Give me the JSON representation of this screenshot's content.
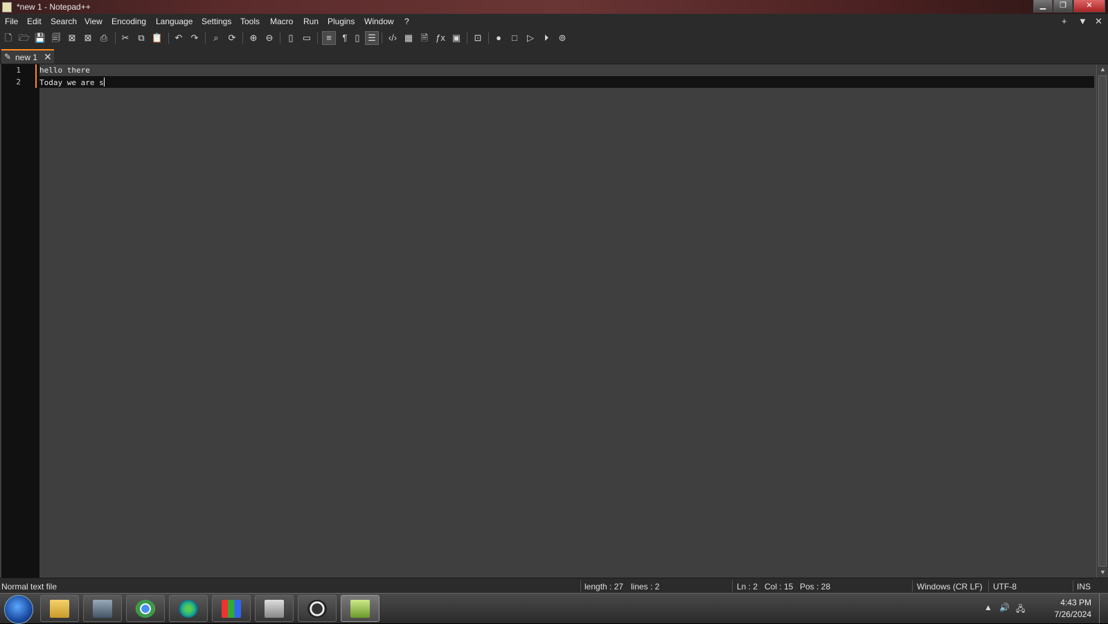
{
  "window": {
    "title": "*new 1 - Notepad++",
    "controls": [
      "minimize",
      "restore",
      "close"
    ]
  },
  "menu": {
    "items": [
      "File",
      "Edit",
      "Search",
      "View",
      "Encoding",
      "Language",
      "Settings",
      "Tools",
      "Macro",
      "Run",
      "Plugins",
      "Window",
      "?"
    ],
    "right_controls": [
      "+",
      "▼",
      "✕"
    ]
  },
  "toolbar": {
    "icons": [
      "new-file-icon",
      "open-file-icon",
      "save-icon",
      "save-all-icon",
      "close-icon",
      "close-all-icon",
      "print-icon",
      "cut-icon",
      "copy-icon",
      "paste-icon",
      "undo-icon",
      "redo-icon",
      "find-icon",
      "replace-icon",
      "zoom-in-icon",
      "zoom-out-icon",
      "sync-vertical-icon",
      "sync-horizontal-icon",
      "word-wrap-icon",
      "show-all-chars-icon",
      "indent-guide-icon",
      "doc-map-icon",
      "udl-icon",
      "function-list-icon",
      "folder-workspace-icon",
      "function-icon",
      "monitoring-icon",
      "doc-switcher-icon",
      "record-macro-icon",
      "stop-record-icon",
      "play-macro-icon",
      "run-macro-multiple-icon",
      "save-macro-icon"
    ]
  },
  "tab": {
    "label": "new 1",
    "close": "✕"
  },
  "editor": {
    "lines": [
      {
        "num": "1",
        "text": "hello there"
      },
      {
        "num": "2",
        "text": "Today we are s"
      }
    ]
  },
  "statusbar": {
    "file_type": "Normal text file",
    "length": "length : 27",
    "lines": "lines : 2",
    "ln": "Ln : 2",
    "col": "Col : 15",
    "pos": "Pos : 28",
    "eol": "Windows (CR LF)",
    "encoding": "UTF-8",
    "mode": "INS"
  },
  "taskbar": {
    "apps": [
      "file-explorer",
      "computer-app",
      "chrome",
      "network-app",
      "color-app",
      "printer-app",
      "obs-studio",
      "notepad-plus-plus"
    ],
    "active_app": "notepad-plus-plus",
    "time": "4:43 PM",
    "date": "7/26/2024"
  }
}
